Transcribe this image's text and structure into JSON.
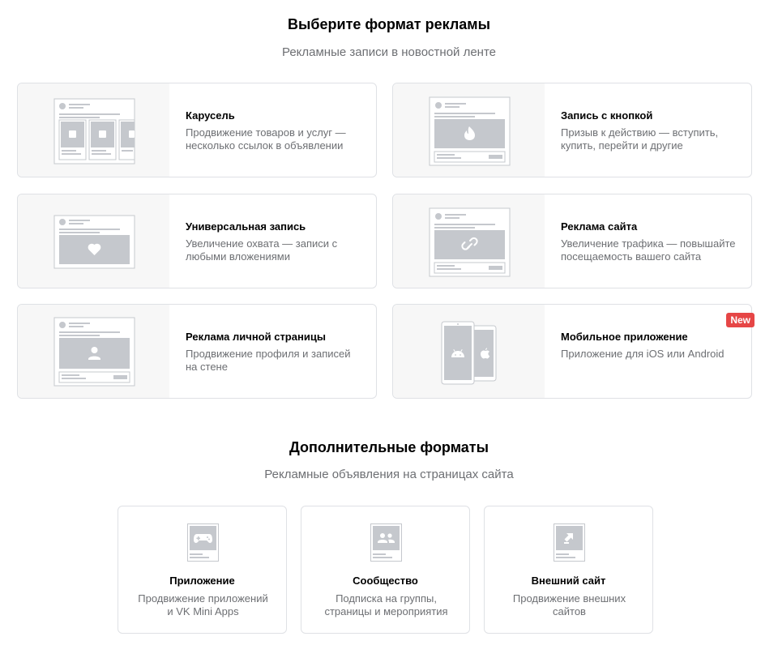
{
  "main_section": {
    "title": "Выберите формат рекламы",
    "subtitle": "Рекламные записи в новостной ленте"
  },
  "formats": [
    {
      "title": "Карусель",
      "desc_line1": "Продвижение товаров и услуг —",
      "desc_line2": "несколько ссылок в объявлении",
      "icon": "carousel-preview-icon"
    },
    {
      "title": "Запись с кнопкой",
      "desc_line1": "Призыв к действию — вступить,",
      "desc_line2": "купить, перейти и другие",
      "icon": "fire-post-preview-icon"
    },
    {
      "title": "Универсальная запись",
      "desc_line1": "Увеличение охвата — записи с",
      "desc_line2": "любыми вложениями",
      "icon": "heart-post-preview-icon"
    },
    {
      "title": "Реклама сайта",
      "desc_line1": "Увеличение трафика — повышайте",
      "desc_line2": "посещаемость вашего сайта",
      "icon": "link-post-preview-icon"
    },
    {
      "title": "Реклама личной страницы",
      "desc_line1": "Продвижение профиля и записей",
      "desc_line2": "на стене",
      "icon": "profile-post-preview-icon"
    },
    {
      "title": "Мобильное приложение",
      "desc_line1": "Приложение для iOS или Android",
      "desc_line2": "",
      "icon": "mobile-phones-preview-icon",
      "badge": "New"
    }
  ],
  "extra_section": {
    "title": "Дополнительные форматы",
    "subtitle": "Рекламные объявления на страницах сайта"
  },
  "extra_formats": [
    {
      "title": "Приложение",
      "desc_line1": "Продвижение приложений",
      "desc_line2": "и VK Mini Apps",
      "icon": "gamepad-icon"
    },
    {
      "title": "Сообщество",
      "desc_line1": "Подписка на группы,",
      "desc_line2": "страницы и мероприятия",
      "icon": "community-icon"
    },
    {
      "title": "Внешний сайт",
      "desc_line1": "Продвижение внешних",
      "desc_line2": "сайтов",
      "icon": "external-link-icon"
    }
  ],
  "colors": {
    "card_border": "#dfe1e5",
    "thumb_bg": "#f7f7f7",
    "placeholder_gray": "#c5c8cd",
    "badge_red": "#e64646",
    "muted_text": "#6d6f73"
  }
}
